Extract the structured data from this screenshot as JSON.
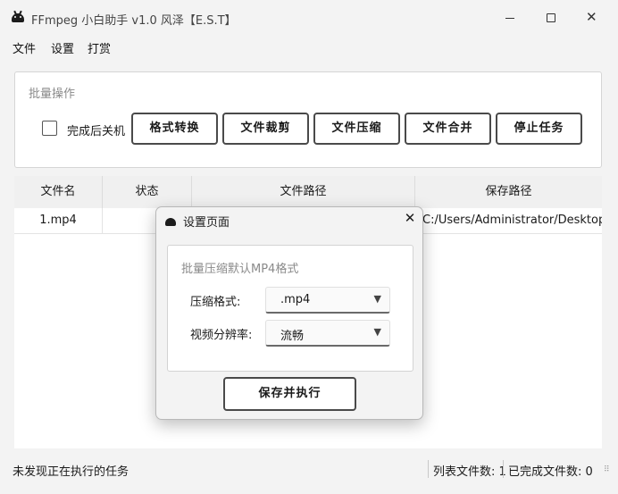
{
  "window": {
    "title": "FFmpeg 小白助手 v1.0 风泽【E.S.T】"
  },
  "icons": {
    "app": "android-app-icon",
    "minimize": "minimize-icon",
    "maximize": "maximize-icon",
    "close": "close-icon"
  },
  "menu": [
    "文件",
    "设置",
    "打赏"
  ],
  "batch": {
    "title": "批量操作",
    "shutdown_label": "完成后关机",
    "shutdown_checked": false,
    "buttons": [
      "格式转换",
      "文件裁剪",
      "文件压缩",
      "文件合并",
      "停止任务"
    ]
  },
  "table": {
    "columns": [
      "文件名",
      "状态",
      "文件路径",
      "保存路径"
    ],
    "rows": [
      {
        "name": "1.mp4",
        "status": "",
        "path": "",
        "save_path": "C:/Users/Administrator/Desktop..."
      }
    ]
  },
  "status": {
    "message": "未发现正在执行的任务",
    "list_count": "列表文件数: 1",
    "done_count": "已完成文件数: 0"
  },
  "dialog": {
    "title": "设置页面",
    "close_glyph": "✕",
    "group_title": "批量压缩默认MP4格式",
    "format_label": "压缩格式:",
    "format_value": ".mp4",
    "resolution_label": "视频分辨率:",
    "resolution_value": "流畅",
    "dropdown_glyph": "▼",
    "submit_label": "保存并执行"
  }
}
